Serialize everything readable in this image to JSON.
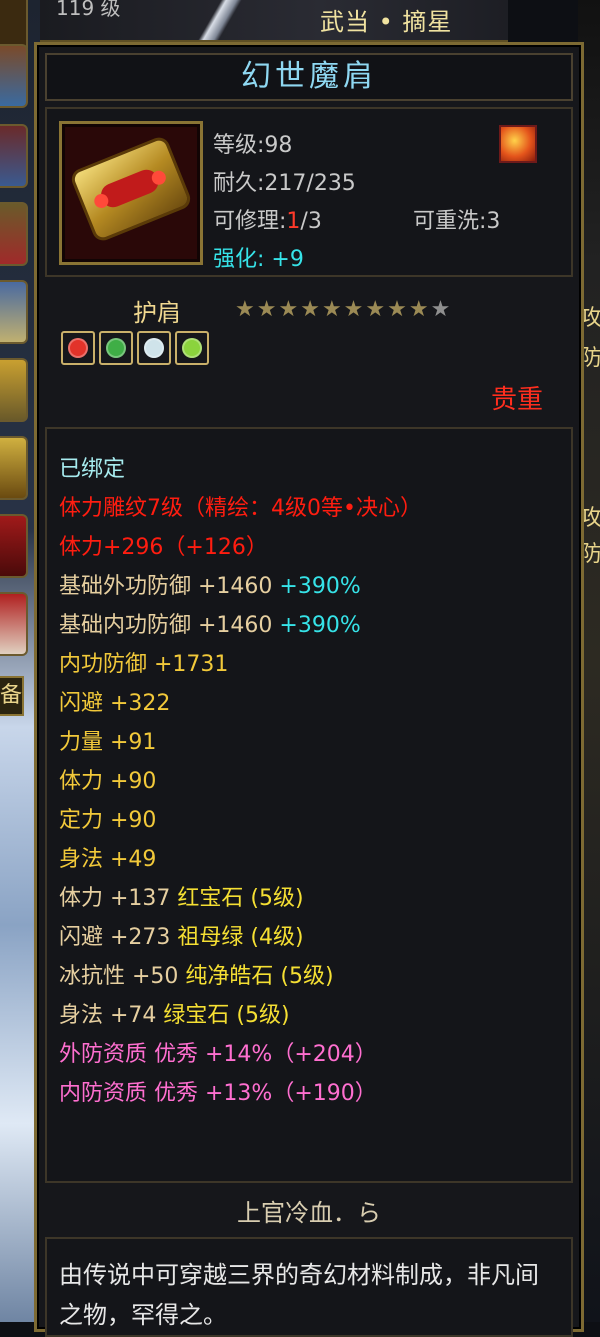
{
  "top_bar": {
    "level_fragment": "119 级",
    "school_skill": "武当 • 摘星"
  },
  "item": {
    "name": "幻世魔肩",
    "level_label": "等级:98",
    "durability_label": "耐久:217/235",
    "repair_prefix": "可修理:",
    "repair_used": "1",
    "repair_total": "/3",
    "rewash_label": "可重洗:3",
    "enhance_label": "强化:",
    "enhance_value": "+9",
    "slot_type": "护肩",
    "stars_filled": 9,
    "stars_total": 10,
    "gem_sockets": [
      {
        "name": "ruby-gem-icon",
        "color": "#e2332a"
      },
      {
        "name": "emerald-gem-icon",
        "color": "#3fae46"
      },
      {
        "name": "pure-white-gem-icon",
        "color": "#cfe3ea"
      },
      {
        "name": "green-gem-icon",
        "color": "#8bd33d"
      }
    ],
    "rarity": "贵重"
  },
  "attributes": {
    "bound": "已绑定",
    "engrave": "体力雕纹7级（精绘：4级0等•决心）",
    "engrave_bonus": "体力+296（+126）",
    "base_outer_def_label": "基础外功防御 +1460",
    "base_outer_def_pct": "+390%",
    "base_inner_def_label": "基础内功防御 +1460",
    "base_inner_def_pct": "+390%",
    "inner_def": "内功防御 +1731",
    "dodge": "闪避 +322",
    "strength": "力量 +91",
    "stamina": "体力 +90",
    "focus": "定力 +90",
    "agility": "身法 +49",
    "gem_stats": [
      {
        "stat": "体力 +137",
        "gem": "红宝石 (5级)"
      },
      {
        "stat": "闪避 +273",
        "gem": "祖母绿 (4级)"
      },
      {
        "stat": "冰抗性 +50",
        "gem": "纯净皓石 (5级)"
      },
      {
        "stat": "身法 +74",
        "gem": "绿宝石 (5级)"
      }
    ],
    "outer_quality": "外防资质  优秀 +14%（+204）",
    "inner_quality": "内防资质  优秀 +13%（+190）"
  },
  "maker": "上官冷血．ら",
  "description": "由传说中可穿越三界的奇幻材料制成，非凡间之物，罕得之。",
  "side_fragments": {
    "left_tab": "备",
    "right_a": "攻",
    "right_b": "防",
    "right_c": "攻",
    "right_d": "防"
  }
}
